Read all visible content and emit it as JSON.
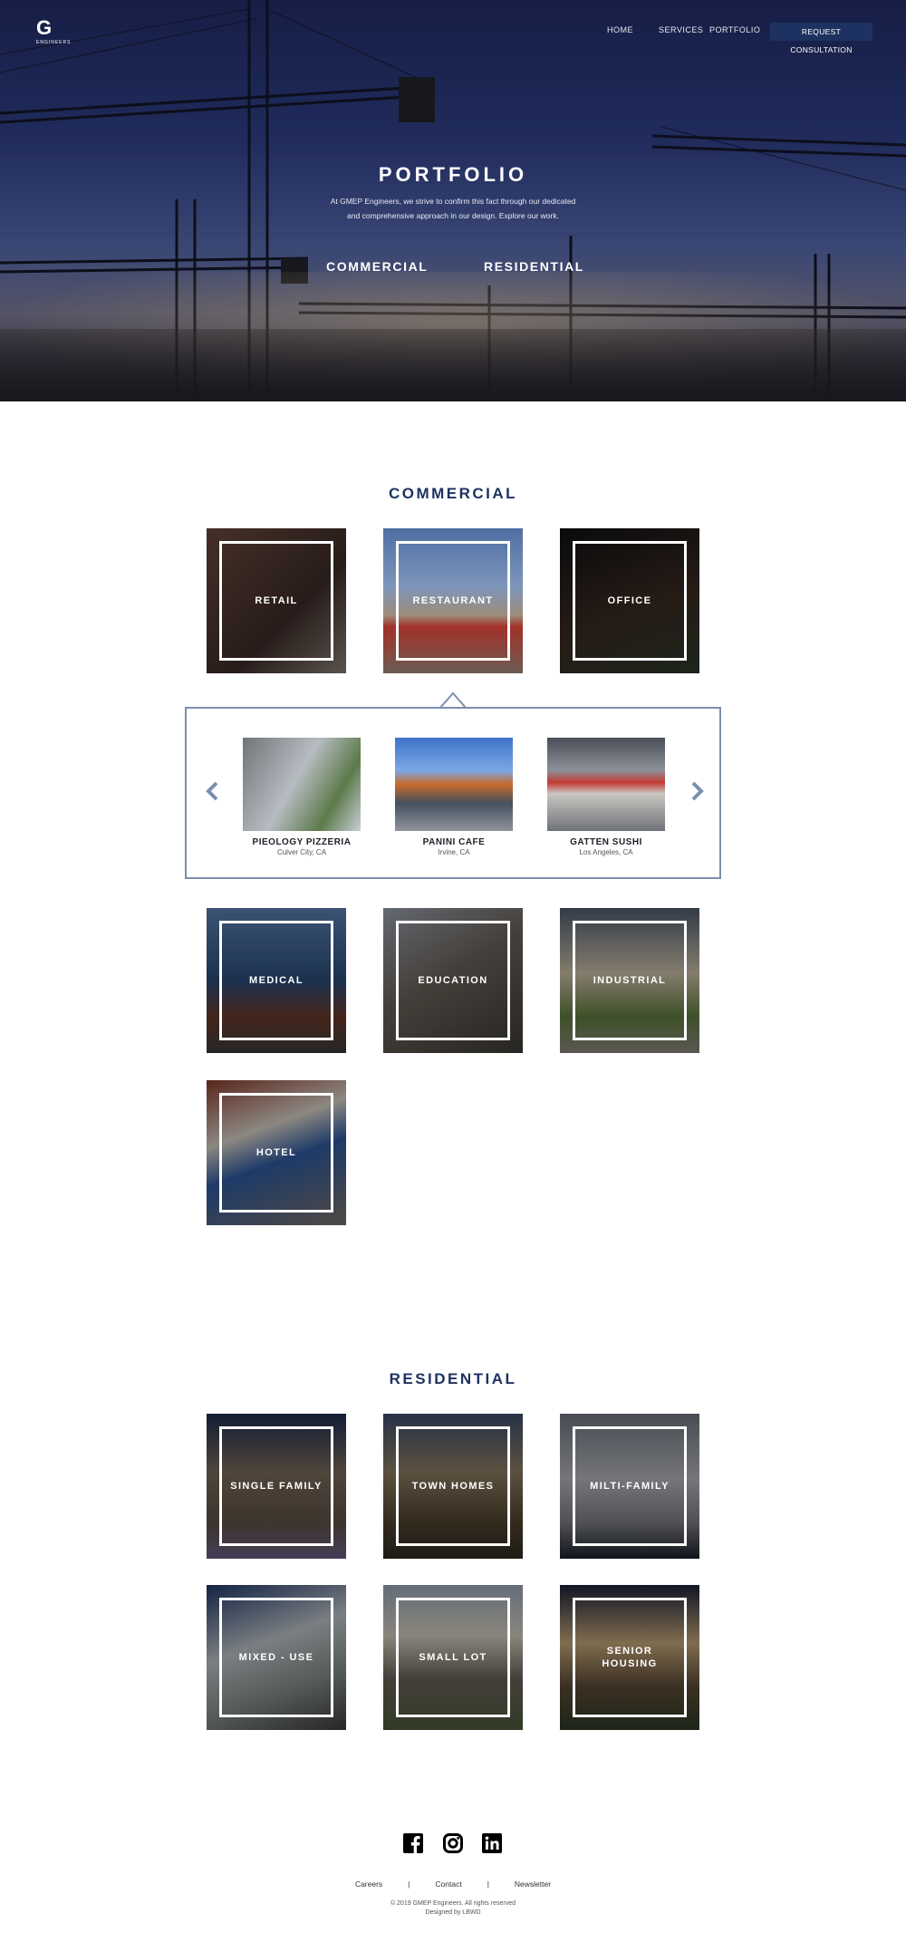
{
  "brand": {
    "logo_mark": "G",
    "logo_word": "ENGINEERS"
  },
  "nav": {
    "home": "HOME",
    "services": "SERVICES",
    "portfolio": "PORTFOLIO",
    "cta": "REQUEST CONSULTATION"
  },
  "hero": {
    "title": "PORTFOLIO",
    "subtitle": "At GMEP Engineers, we strive to confirm this fact through our dedicated and comprehensive approach in our design. Explore our work.",
    "link_commercial": "COMMERCIAL",
    "link_residential": "RESIDENTIAL"
  },
  "commercial": {
    "title": "COMMERCIAL",
    "tiles": [
      "RETAIL",
      "RESTAURANT",
      "OFFICE",
      "MEDICAL",
      "EDUCATION",
      "INDUSTRIAL",
      "HOTEL"
    ],
    "projects": [
      {
        "name": "PIEOLOGY PIZZERIA",
        "location": "Culver City, CA"
      },
      {
        "name": "PANINI CAFE",
        "location": "Irvine, CA"
      },
      {
        "name": "GATTEN SUSHI",
        "location": "Los Angeles, CA"
      }
    ]
  },
  "residential": {
    "title": "RESIDENTIAL",
    "tiles": [
      "SINGLE FAMILY",
      "TOWN HOMES",
      "MILTI-FAMILY",
      "MIXED - USE",
      "SMALL LOT",
      "SENIOR HOUSING"
    ]
  },
  "footer": {
    "links": [
      "Careers",
      "Contact",
      "Newsletter"
    ],
    "separator": "|",
    "copyright": "© 2019 GMEP Engineers. All rights reserved",
    "designed_by": "Designed by LBWD"
  },
  "icons": [
    "facebook-icon",
    "instagram-icon",
    "linkedin-icon",
    "chevron-left-icon",
    "chevron-right-icon"
  ],
  "colors": {
    "navy": "#1d3260",
    "frame": "#7d8fae"
  }
}
